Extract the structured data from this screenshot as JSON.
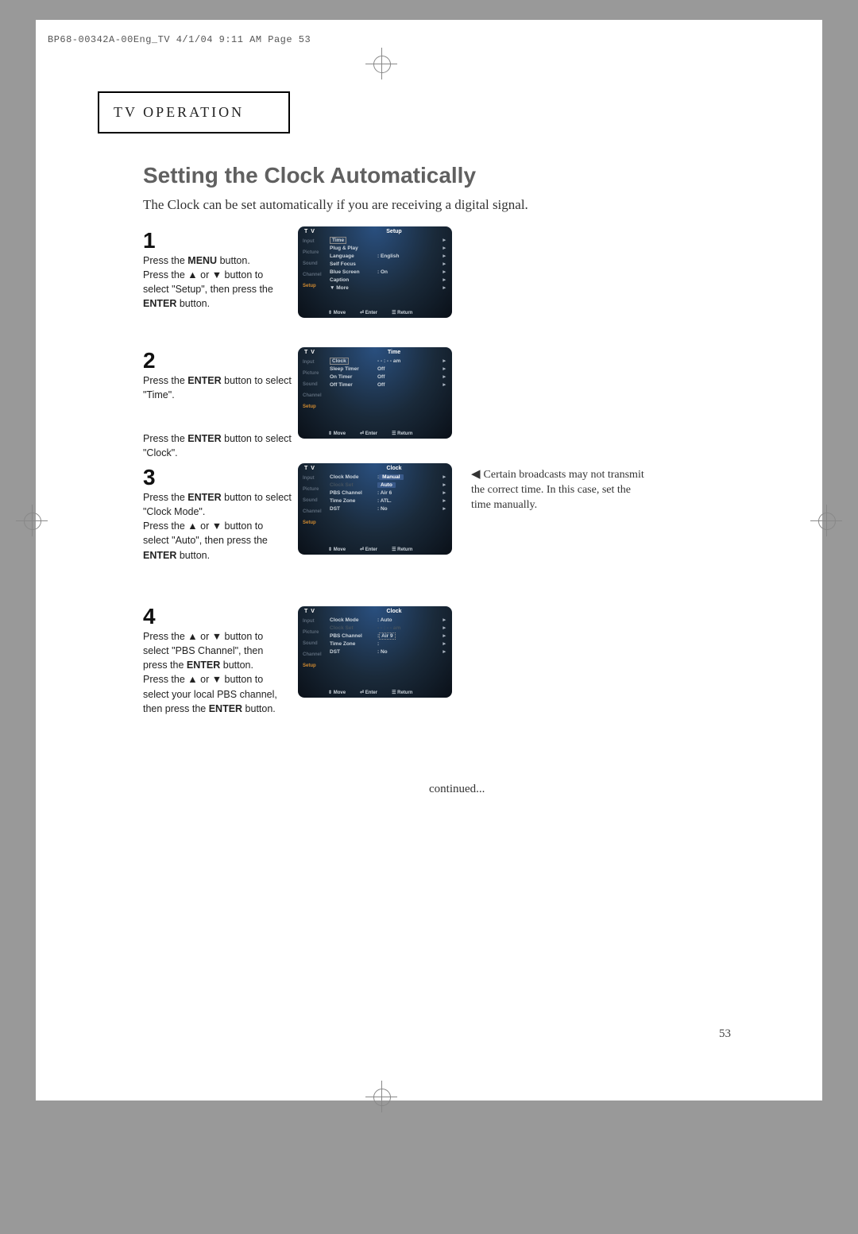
{
  "print_header": "BP68-00342A-00Eng_TV  4/1/04  9:11 AM  Page 53",
  "section_label": "TV OPERATION",
  "title": "Setting the Clock Automatically",
  "subtitle": "The Clock can be set automatically if you are receiving a digital signal.",
  "steps": {
    "s1": {
      "num": "1",
      "lines": [
        "Press the <b>MENU</b> button.",
        "Press the ▲ or ▼ button to",
        "select \"Setup\", then press the",
        "<b>ENTER</b> button."
      ]
    },
    "s2": {
      "num": "2",
      "lines": [
        "Press the <b>ENTER</b> button to select",
        "\"Time\".",
        "",
        "Press the <b>ENTER</b> button to select",
        "\"Clock\"."
      ]
    },
    "s3": {
      "num": "3",
      "lines": [
        "Press the <b>ENTER</b> button to select",
        "\"Clock Mode\".",
        "Press the ▲ or ▼ button to",
        "select \"Auto\", then press the",
        "<b>ENTER</b> button."
      ]
    },
    "s4": {
      "num": "4",
      "lines": [
        "Press the ▲ or ▼ button to",
        "select \"PBS Channel\", then",
        "press the <b>ENTER</b> button.",
        "Press the ▲ or ▼ button to",
        "select your local PBS channel,",
        "then press the <b>ENTER</b> button."
      ]
    }
  },
  "side_note": "Certain broadcasts may not transmit the correct time. In this case, set the time manually.",
  "continued": "continued...",
  "page_num": "53",
  "tv": {
    "sidebar": [
      "Input",
      "Picture",
      "Sound",
      "Channel",
      "Setup"
    ],
    "footer": {
      "move": "Move",
      "enter": "Enter",
      "return": "Return"
    },
    "s1": {
      "title": "Setup",
      "rows": [
        {
          "label": "Time",
          "boxed": true
        },
        {
          "label": "Plug & Play"
        },
        {
          "label": "Language",
          "val": ": English"
        },
        {
          "label": "Self Focus"
        },
        {
          "label": "Blue Screen",
          "val": ": On"
        },
        {
          "label": "Caption"
        },
        {
          "label": "▼ More"
        }
      ],
      "active_side": 4
    },
    "s2": {
      "title": "Time",
      "rows": [
        {
          "label": "Clock",
          "val": "- - : - - am",
          "boxed": true
        },
        {
          "label": "Sleep Timer",
          "val": "Off"
        },
        {
          "label": "On Timer",
          "val": "Off"
        },
        {
          "label": "Off Timer",
          "val": "Off"
        }
      ],
      "active_side": 4
    },
    "s3": {
      "title": "Clock",
      "rows": [
        {
          "label": "Clock Mode",
          "val": ":",
          "hl": "Manual"
        },
        {
          "label": "Clock Set",
          "dim": true,
          "hl": "Auto"
        },
        {
          "label": "PBS Channel",
          "val": ": Air     6"
        },
        {
          "label": "Time Zone",
          "val": ": ATL."
        },
        {
          "label": "DST",
          "val": ": No"
        }
      ],
      "active_side": 4
    },
    "s4": {
      "title": "Clock",
      "rows": [
        {
          "label": "Clock Mode",
          "val": ": Auto"
        },
        {
          "label": "Clock Set",
          "val": "- - : - - am",
          "dim": true
        },
        {
          "label": "PBS Channel",
          "val": ":",
          "spin": "Air     9"
        },
        {
          "label": "Time Zone",
          "val": ":"
        },
        {
          "label": "DST",
          "val": ": No"
        }
      ],
      "active_side": 4
    }
  }
}
